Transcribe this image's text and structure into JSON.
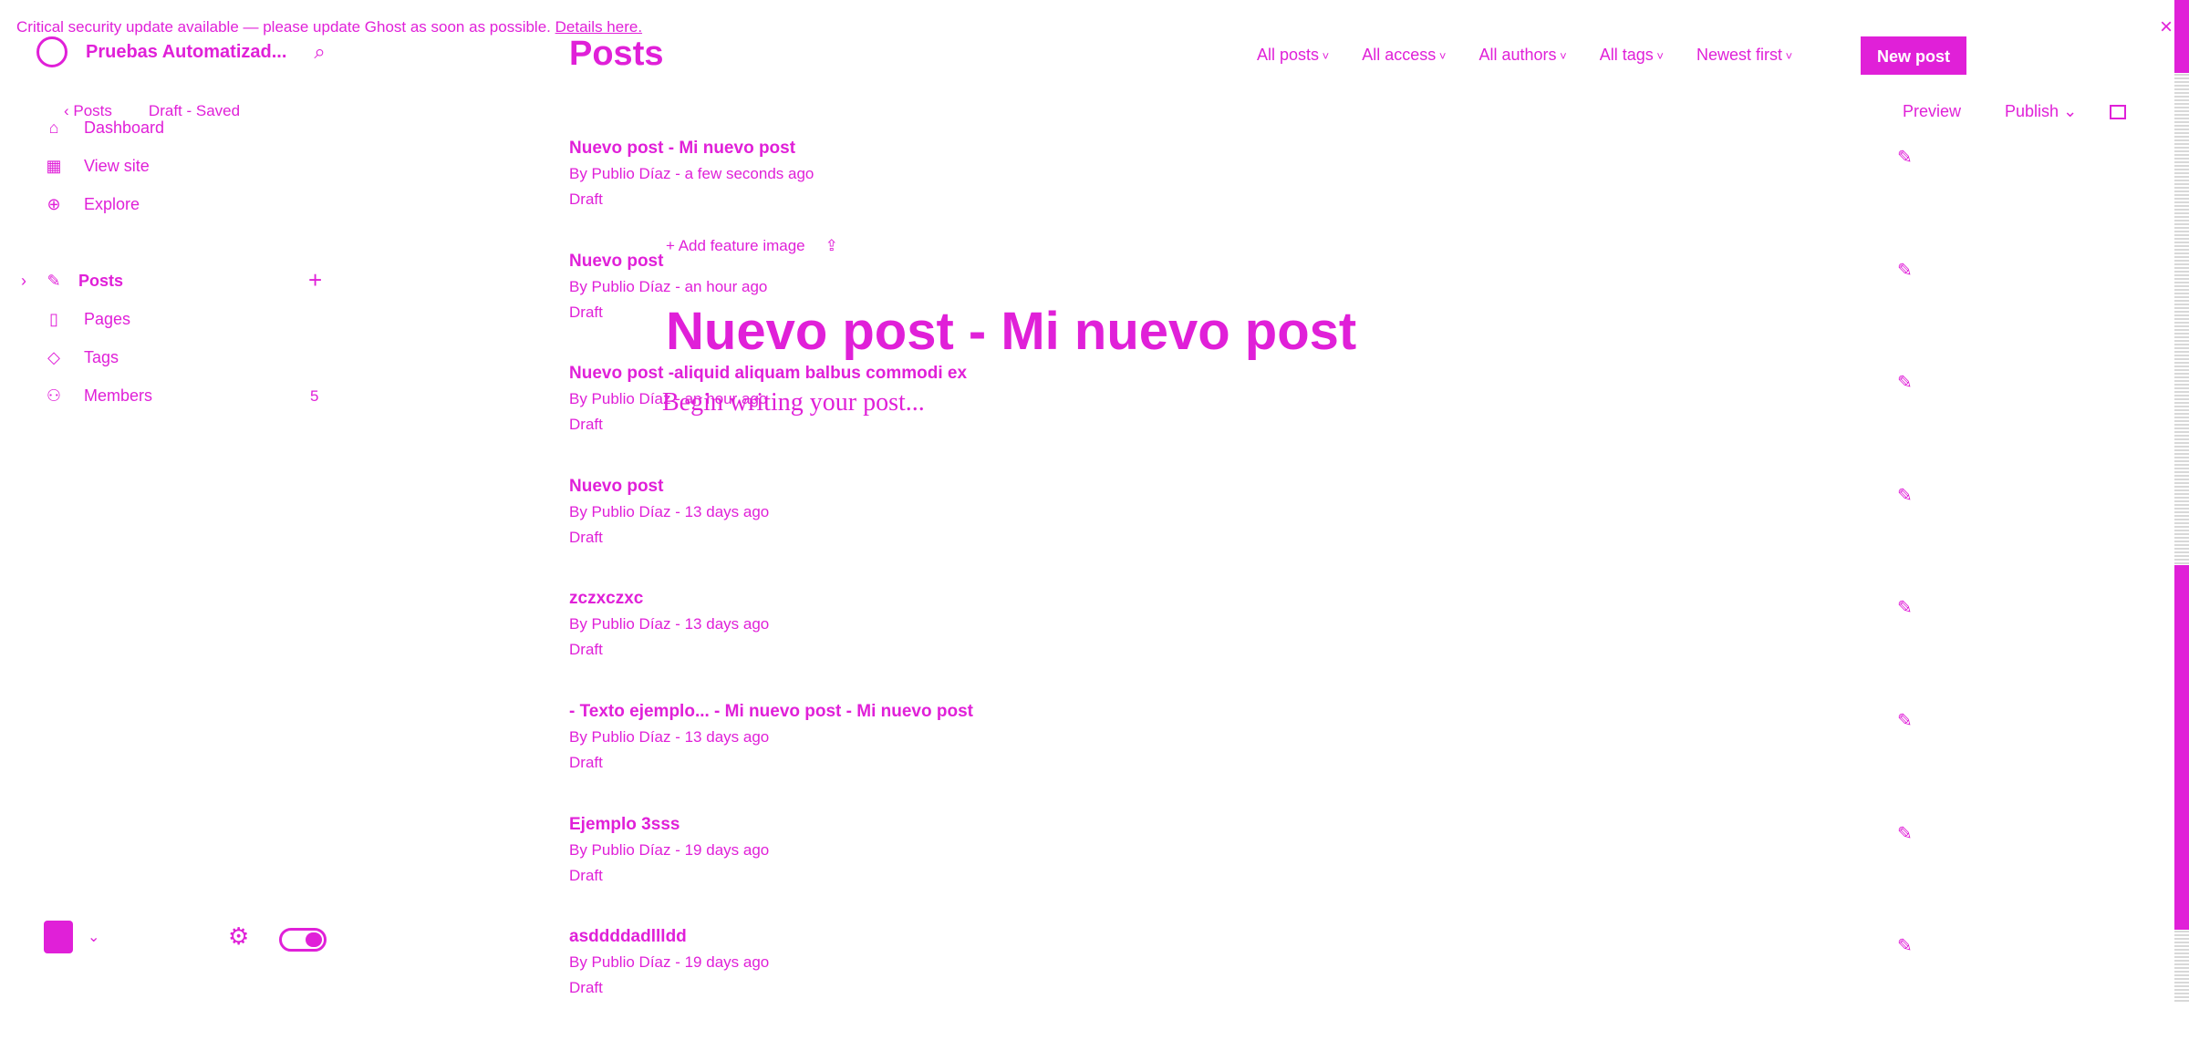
{
  "banner": {
    "text": "Critical security update available — please update Ghost as soon as possible.",
    "link": "Details here.",
    "close_icon": "close-icon"
  },
  "sidebar": {
    "site_name": "Pruebas Automatizad...",
    "items": [
      {
        "label": "Dashboard",
        "icon": "home-icon"
      },
      {
        "label": "View site",
        "icon": "layout-icon"
      },
      {
        "label": "Explore",
        "icon": "globe-icon"
      },
      {
        "label": "Posts",
        "icon": "edit-icon"
      },
      {
        "label": "Pages",
        "icon": "page-icon"
      },
      {
        "label": "Tags",
        "icon": "tag-icon"
      },
      {
        "label": "Members",
        "icon": "members-icon",
        "count": "5"
      }
    ]
  },
  "editor": {
    "back_label": "Posts",
    "status": "Draft - Saved",
    "preview": "Preview",
    "publish": "Publish",
    "add_feature_image": "Add feature image",
    "title": "Nuevo post - Mi nuevo post",
    "body_placeholder": "Begin writing your post..."
  },
  "header": {
    "title": "Posts",
    "filters": [
      "All posts",
      "All access",
      "All authors",
      "All tags",
      "Newest first"
    ],
    "new_post": "New post"
  },
  "posts": [
    {
      "title": "Nuevo post - Mi nuevo post",
      "meta": "By Publio Díaz - a few seconds ago",
      "status": "Draft"
    },
    {
      "title": "Nuevo post",
      "meta": "By Publio Díaz - an hour ago",
      "status": "Draft"
    },
    {
      "title": "Nuevo post -aliquid aliquam balbus commodi ex",
      "meta": "By Publio Díaz - an hour ago",
      "status": "Draft"
    },
    {
      "title": "Nuevo post",
      "meta": "By Publio Díaz - 13 days ago",
      "status": "Draft"
    },
    {
      "title": "zczxczxc",
      "meta": "By Publio Díaz - 13 days ago",
      "status": "Draft"
    },
    {
      "title": "- Texto ejemplo... - Mi nuevo post - Mi nuevo post",
      "meta": "By Publio Díaz - 13 days ago",
      "status": "Draft"
    },
    {
      "title": "Ejemplo 3sss",
      "meta": "By Publio Díaz - 19 days ago",
      "status": "Draft"
    },
    {
      "title": "asddddadllldd",
      "meta": "By Publio Díaz - 19 days ago",
      "status": "Draft"
    }
  ],
  "colors": {
    "accent": "#e020d8",
    "background": "#ffffff"
  }
}
